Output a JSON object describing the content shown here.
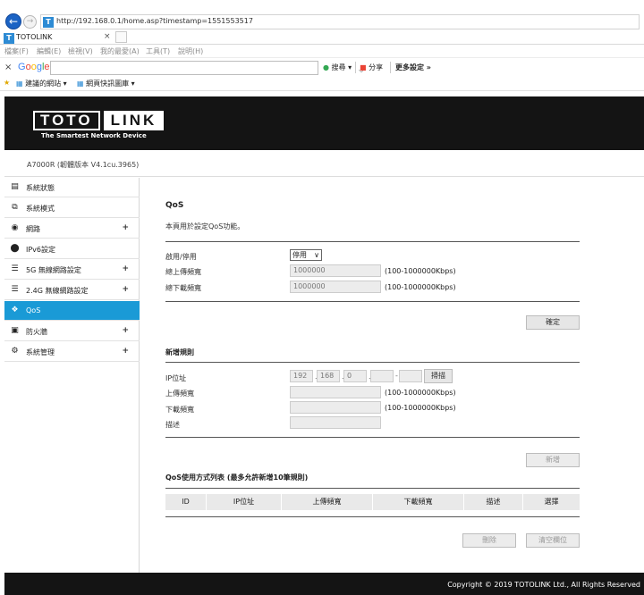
{
  "browser": {
    "url": "http://192.168.0.1/home.asp?timestamp=1551553517",
    "tab_title": "TOTOLINK",
    "favicon_letter": "T",
    "menu": [
      "檔案(F)",
      "編輯(E)",
      "檢視(V)",
      "我的最愛(A)",
      "工具(T)",
      "說明(H)"
    ],
    "google_logo": "Google",
    "google_buttons": [
      "搜尋 ▾",
      "分享",
      "更多設定 »"
    ],
    "favorites": [
      "建議的網站 ▾",
      "網頁快訊圖庫 ▾"
    ]
  },
  "router": {
    "logo_left": "TOTO",
    "logo_right": "LINK",
    "tagline": "The Smartest Network Device",
    "model": "A7000R (韌體版本 V4.1cu.3965)"
  },
  "sidebar": {
    "items": [
      {
        "label": "系統狀態",
        "icon": "status-icon",
        "plus": ""
      },
      {
        "label": "系統模式",
        "icon": "mode-icon",
        "plus": ""
      },
      {
        "label": "網路",
        "icon": "globe-icon",
        "plus": "+"
      },
      {
        "label": "IPv6設定",
        "icon": "ipv6-icon",
        "plus": ""
      },
      {
        "label": "5G 無線網路設定",
        "icon": "wifi-icon",
        "plus": "+"
      },
      {
        "label": "2.4G 無線網路設定",
        "icon": "wifi-icon",
        "plus": "+"
      },
      {
        "label": "QoS",
        "icon": "qos-icon",
        "plus": ""
      },
      {
        "label": "防火牆",
        "icon": "lock-icon",
        "plus": "+"
      },
      {
        "label": "系統管理",
        "icon": "gear-icon",
        "plus": "+"
      }
    ]
  },
  "qos": {
    "title": "QoS",
    "description": "本頁用於設定QoS功能。",
    "enable_label": "啟用/停用",
    "enable_value": "停用",
    "up_label": "總上傳頻寬",
    "up_value": "1000000",
    "down_label": "總下載頻寬",
    "down_value": "1000000",
    "range_hint": "(100-1000000Kbps)",
    "confirm_button": "確定"
  },
  "rule": {
    "title": "新增規則",
    "ip_label": "IP位址",
    "ip1": "192",
    "ip2": "168",
    "ip3": "0",
    "ip4": "",
    "ip5": "",
    "dash": "-",
    "scan_button": "掃描",
    "up_label": "上傳頻寬",
    "down_label": "下載頻寬",
    "desc_label": "描述",
    "range_hint": "(100-1000000Kbps)",
    "add_button": "新增"
  },
  "table": {
    "title": "QoS使用方式列表 (最多允許新增10筆規則)",
    "headers": [
      "ID",
      "IP位址",
      "上傳頻寬",
      "下載頻寬",
      "描述",
      "選擇"
    ],
    "delete_button": "刪除",
    "clear_button": "清空欄位"
  },
  "footer": {
    "copyright": "Copyright © 2019 TOTOLINK Ltd., All Rights Reserved"
  }
}
